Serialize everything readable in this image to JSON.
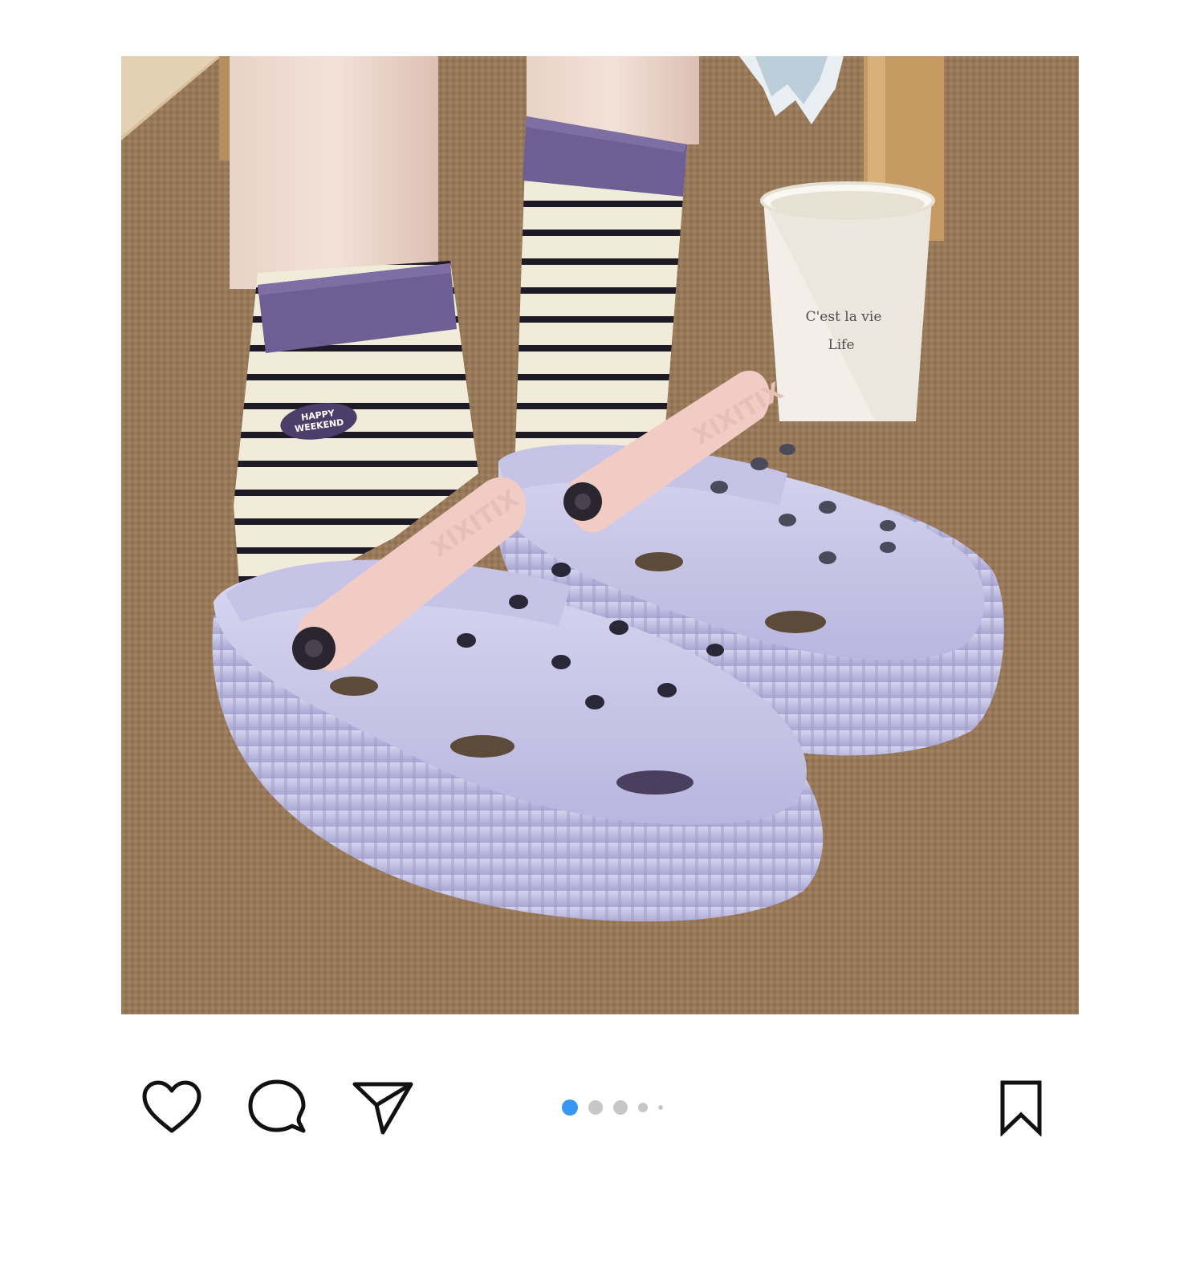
{
  "post": {
    "image": {
      "cup_line1": "C'est la vie",
      "cup_line2": "Life",
      "sock_patch_line1": "HAPPY",
      "sock_patch_line2": "WEEKEND",
      "strap_brand": "XIXITIX"
    },
    "carousel": {
      "total_dots": 5,
      "active_index": 0
    }
  },
  "actions": {
    "like": "heart-icon",
    "comment": "comment-icon",
    "share": "paper-plane-icon",
    "save": "bookmark-icon"
  },
  "colors": {
    "active_dot": "#3897f0",
    "inactive_dot": "#c7c7c7",
    "icon_stroke": "#111111"
  }
}
